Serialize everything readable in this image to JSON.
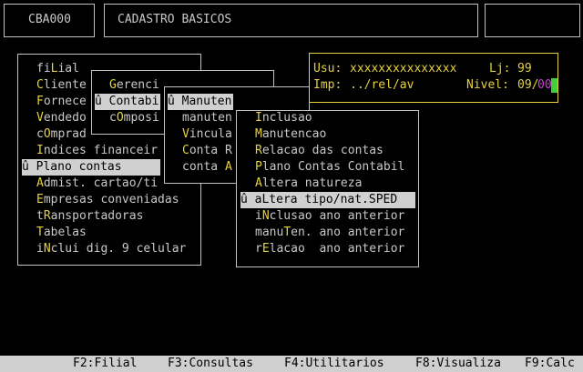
{
  "header": {
    "code": "CBA000",
    "title": "CADASTRO BASICOS"
  },
  "info": {
    "usu_label": "Usu:",
    "usu_value": "xxxxxxxxxxxxxxx",
    "lj_label": "Lj:",
    "lj_value": "99",
    "imp_label": "Imp:",
    "imp_value": "../rel/av",
    "nivel_label": "Nivel:",
    "nivel_value_a": "09/",
    "nivel_value_b": "00"
  },
  "menu1": [
    {
      "hot": "",
      "pre": "fi",
      "key": "L",
      "rest": "ial"
    },
    {
      "hot": "C",
      "rest": "liente"
    },
    {
      "hot": "F",
      "rest": "ornece"
    },
    {
      "hot": "V",
      "rest": "endedo"
    },
    {
      "hot": "",
      "pre": "c",
      "key": "O",
      "rest": "mprad"
    },
    {
      "hot": "I",
      "rest": "ndices financeir"
    },
    {
      "selected": true,
      "text": "û Plano contas"
    },
    {
      "hot": "A",
      "rest": "dmist. cartao/ti"
    },
    {
      "hot": "E",
      "rest": "mpresas conveniadas"
    },
    {
      "hot": "",
      "pre": "t",
      "key": "R",
      "rest": "ansportadoras"
    },
    {
      "hot": "T",
      "rest": "abelas"
    },
    {
      "hot": "",
      "pre": "i",
      "key": "N",
      "rest": "clui dig. 9 celular"
    }
  ],
  "menu2": [
    {
      "hot": "G",
      "rest": "erenci"
    },
    {
      "selected": true,
      "text": "û Contabi"
    },
    {
      "hot": "",
      "pre": "c",
      "key": "O",
      "rest": "mposi"
    }
  ],
  "menu3": [
    {
      "selected": true,
      "text": "û Manuten"
    },
    {
      "hot": "",
      "pre": "manuten",
      "key": "",
      "rest": ""
    },
    {
      "hot": "V",
      "rest": "incula"
    },
    {
      "hot": "C",
      "rest": "onta R"
    },
    {
      "hot": "",
      "pre": "conta ",
      "key": "A",
      "rest": ""
    }
  ],
  "menu4": [
    {
      "hot": "I",
      "rest": "nclusao"
    },
    {
      "hot": "M",
      "rest": "anutencao"
    },
    {
      "hot": "R",
      "rest": "elacao das contas"
    },
    {
      "hot": "P",
      "rest": "lano Contas Contabil"
    },
    {
      "hot": "A",
      "rest": "ltera natureza"
    },
    {
      "selected": true,
      "text": "û aLtera tipo/nat.SPED"
    },
    {
      "hot": "",
      "pre": "i",
      "key": "N",
      "rest": "clusao ano anterior"
    },
    {
      "hot": "",
      "pre": "manu",
      "key": "T",
      "rest": "en. ano anterior"
    },
    {
      "hot": "",
      "pre": "r",
      "key": "E",
      "rest": "lacao  ano anterior"
    }
  ],
  "footer": {
    "f2": "F2:Filial",
    "f3": "F3:Consultas",
    "f4": "F4:Utilitarios",
    "f8": "F8:Visualiza",
    "f9": "F9:Calc"
  }
}
